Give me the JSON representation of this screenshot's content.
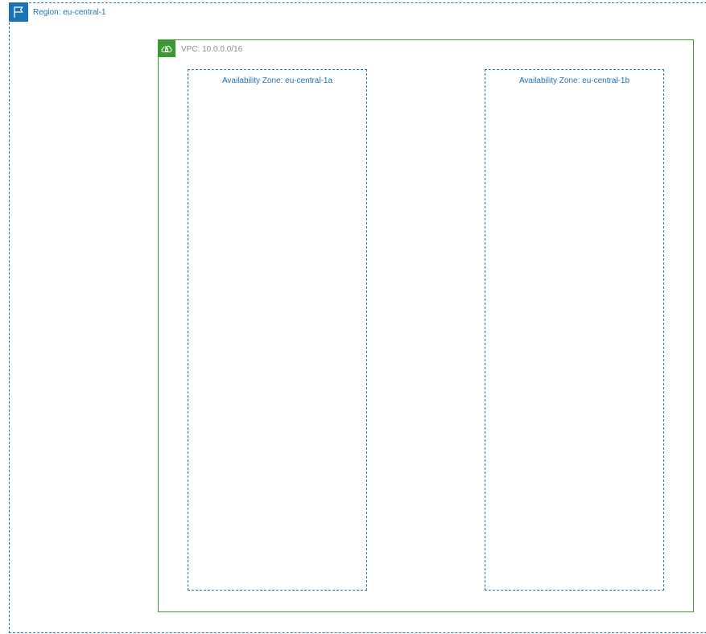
{
  "region": {
    "label": "Region: eu-central-1",
    "icon": "flag-icon",
    "color": "#1a73b5"
  },
  "vpc": {
    "label": "VPC: 10.0.0.0/16",
    "icon": "cloud-lock-icon",
    "color": "#3a9a32"
  },
  "availability_zones": [
    {
      "label": "Availability Zone: eu-central-1a"
    },
    {
      "label": "Availability Zone: eu-central-1b"
    }
  ]
}
